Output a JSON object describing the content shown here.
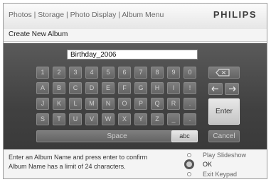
{
  "header": {
    "breadcrumb": "Photos | Storage | Photo Display | Album Menu",
    "brand": "PHILIPS",
    "subtitle": "Create New Album"
  },
  "keyboard": {
    "album_name": "Birthday_2006",
    "rows": [
      [
        "1",
        "2",
        "3",
        "4",
        "5",
        "6",
        "7",
        "8",
        "9",
        "0"
      ],
      [
        "A",
        "B",
        "C",
        "D",
        "E",
        "F",
        "G",
        "H",
        "I",
        "!"
      ],
      [
        "J",
        "K",
        "L",
        "M",
        "N",
        "O",
        "P",
        "Q",
        "R",
        "."
      ],
      [
        "S",
        "T",
        "U",
        "V",
        "W",
        "X",
        "Y",
        "Z",
        "_",
        "."
      ]
    ],
    "backspace_icon": "backspace-icon",
    "left_arrow_icon": "arrow-left-icon",
    "right_arrow_icon": "arrow-right-icon",
    "enter_label": "Enter",
    "space_label": "Space",
    "abc_label": "abc",
    "cancel_label": "Cancel"
  },
  "footer": {
    "hint_line1": "Enter an Album Name and press enter to confirm",
    "hint_line2": "Album Name has a limit of 24 characters.",
    "options": [
      {
        "label": "Play Slideshow",
        "selected": false
      },
      {
        "label": "OK",
        "selected": true
      },
      {
        "label": "Exit Keypad",
        "selected": false
      }
    ]
  }
}
